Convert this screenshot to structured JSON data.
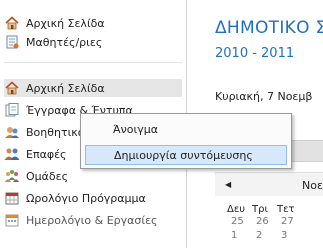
{
  "sidebar": {
    "top_items": [
      {
        "label": "Αρχική Σελίδα",
        "icon": "home-icon"
      },
      {
        "label": "Μαθητές/ριες",
        "icon": "document-icon"
      }
    ],
    "items": [
      {
        "label": "Αρχική Σελίδα",
        "icon": "home-icon"
      },
      {
        "label": "Έγγραφα & Έντυπα",
        "icon": "documents-icon"
      },
      {
        "label": "Βοηθητικά",
        "icon": "help-icon"
      },
      {
        "label": "Επαφές",
        "icon": "contacts-icon"
      },
      {
        "label": "Ομάδες",
        "icon": "groups-icon"
      },
      {
        "label": "Ωρολόγιο Πρόγραμμα",
        "icon": "timetable-icon"
      },
      {
        "label": "Ημερολόγιο & Εργασίες",
        "icon": "calendar-icon"
      }
    ]
  },
  "main": {
    "title": "ΔΗΜΟΤΙΚΟ Σ",
    "year": "2010 - 2011",
    "date": "Κυριακή, 7 Νοεμβ",
    "calendar": {
      "month": "Νοεμβ",
      "day_headers": [
        "Δευ",
        "Τρι",
        "Τετ"
      ],
      "row1": [
        "25",
        "26",
        "27"
      ],
      "row2": [
        "1",
        "2",
        "3"
      ]
    }
  },
  "context_menu": {
    "items": [
      "Άνοιγμα",
      "Δημιουργία συντόμευσης"
    ]
  },
  "colors": {
    "accent": "#1f6fc5",
    "selection": "#e6e6e6",
    "menu_hover": "#d6e8fa"
  }
}
